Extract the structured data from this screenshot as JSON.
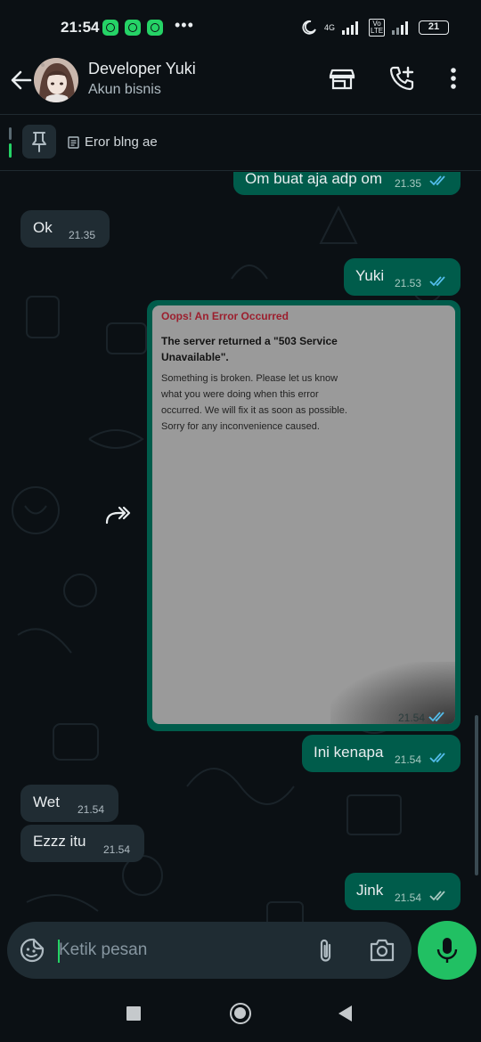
{
  "status_bar": {
    "time": "21:54",
    "notification_icons": [
      "whatsapp-icon",
      "whatsapp-icon",
      "whatsapp-icon"
    ],
    "more": "•••",
    "network_top": "4G",
    "lte_label": "Vo LTE",
    "battery": "21"
  },
  "header": {
    "back_icon": "arrow-left-icon",
    "contact_name": "Developer Yuki",
    "contact_status": "Akun bisnis",
    "actions": [
      "store-icon",
      "add-call-icon",
      "more-vertical-icon"
    ]
  },
  "pinned": {
    "icon": "pin-icon",
    "message": "Eror blng ae"
  },
  "messages": [
    {
      "direction": "out",
      "text": "Om buat aja adp om",
      "time": "21.35",
      "status": "read"
    },
    {
      "direction": "in",
      "text": "Ok",
      "time": "21.35"
    },
    {
      "direction": "out",
      "text": "Yuki",
      "time": "21.53",
      "status": "read"
    },
    {
      "direction": "out",
      "type": "image",
      "time": "21.54",
      "status": "read",
      "image": {
        "title": "Oops! An Error Occurred",
        "heading": "The server returned a \"503 Service Unavailable\".",
        "body": "Something is broken. Please let us know what you were doing when this error occurred. We will fix it as soon as possible. Sorry for any inconvenience caused."
      }
    },
    {
      "direction": "out",
      "text": "Ini kenapa",
      "time": "21.54",
      "status": "read"
    },
    {
      "direction": "in",
      "text": "Wet",
      "time": "21.54"
    },
    {
      "direction": "in",
      "text": "Ezzz itu",
      "time": "21.54"
    },
    {
      "direction": "out",
      "text": "Jink",
      "time": "21.54",
      "status": "delivered"
    }
  ],
  "input": {
    "placeholder": "Ketik pesan",
    "value": ""
  },
  "colors": {
    "background": "#0b1014",
    "outgoing_bubble": "#005c4b",
    "incoming_bubble": "#202c33",
    "accent_green": "#21c063",
    "read_tick": "#53bdeb",
    "error_title": "#9c1f2e"
  },
  "nav_bar": [
    "recents-square-icon",
    "home-circle-icon",
    "back-triangle-icon"
  ]
}
